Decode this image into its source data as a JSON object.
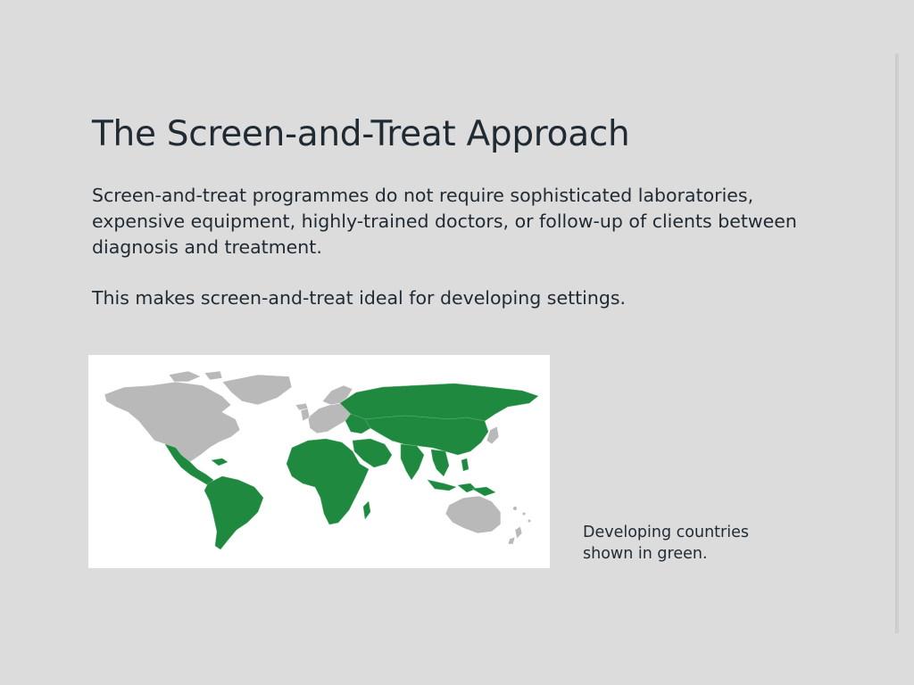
{
  "slide": {
    "title": "The Screen-and-Treat Approach",
    "paragraph_1": "Screen-and-treat programmes do not require sophisticated laboratories, expensive equipment, highly-trained doctors, or follow-up of clients between diagnosis and treatment.",
    "paragraph_2": "This makes screen-and-treat ideal for developing settings.",
    "caption_line_1": "Developing countries",
    "caption_line_2": "shown in green."
  },
  "map": {
    "developing_color": "#1f8a3f",
    "developed_color": "#b9b9b9",
    "background_color": "#ffffff"
  }
}
